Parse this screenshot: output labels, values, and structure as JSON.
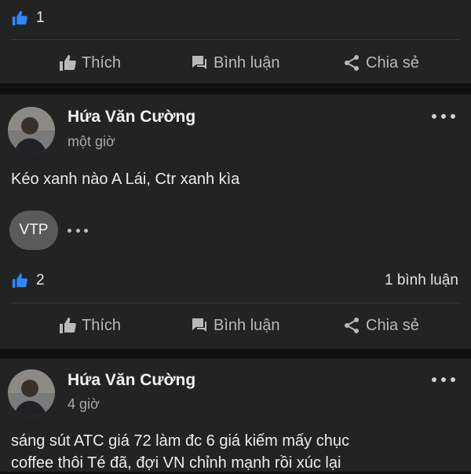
{
  "colors": {
    "background": "#0f0f0f",
    "card": "#232323",
    "like_blue": "#2d88ff",
    "action_text": "#b9b9b9"
  },
  "icons": [
    "like-badge-icon",
    "thumbs-up-icon",
    "comment-icon",
    "share-icon",
    "more-dots-icon"
  ],
  "top_post": {
    "like_count": "1"
  },
  "actions": {
    "like": "Thích",
    "comment": "Bình luận",
    "share": "Chia sẻ"
  },
  "post1": {
    "author": "Hứa Văn Cường",
    "time": "một giờ",
    "text": "Kéo xanh nào A Lái, Ctr xanh kìa",
    "reactor_initials": "VTP",
    "like_count": "2",
    "comment_count": "1 bình luận"
  },
  "post2": {
    "author": "Hứa Văn Cường",
    "time": "4 giờ",
    "text_line1": "sáng sút ATC giá 72 làm đc 6 giá kiếm mấy chục",
    "text_line2": "coffee thôi Té đã, đợi VN chỉnh mạnh rồi xúc lại"
  }
}
